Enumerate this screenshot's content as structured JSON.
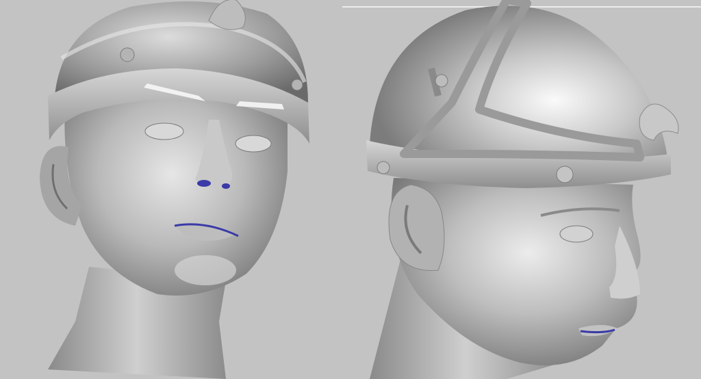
{
  "scene": {
    "background": "#c3c3c3",
    "model_color": "#a8a8a8",
    "highlight_color": "#f2f2f2",
    "shadow_color": "#6e6e6e",
    "lip_line_color": "#3a3aa8"
  },
  "views": [
    {
      "id": "front-three-quarter",
      "icon": "head-with-helmet-render"
    },
    {
      "id": "side-profile",
      "icon": "head-with-helmet-render"
    }
  ]
}
